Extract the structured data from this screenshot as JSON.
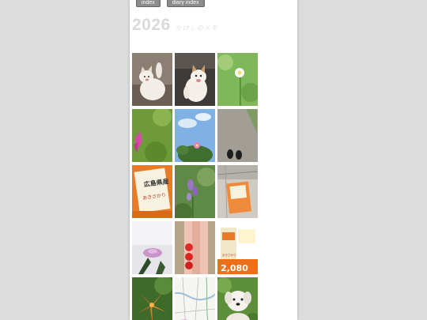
{
  "nav": {
    "index_label": "index",
    "diary_index_label": "diary index"
  },
  "header": {
    "year": "2026",
    "subtitle": "たけしのメモ"
  },
  "photos": [
    {
      "subject": "cat-photo"
    },
    {
      "subject": "cat-photo"
    },
    {
      "subject": "white-flower-photo"
    },
    {
      "subject": "pink-flower-photo"
    },
    {
      "subject": "sky-flower-photo"
    },
    {
      "subject": "shoes-on-pavement-photo"
    },
    {
      "subject": "rice-bag-photo"
    },
    {
      "subject": "purple-flower-photo"
    },
    {
      "subject": "rice-bag-cart-photo"
    },
    {
      "subject": "pink-blossom-photo"
    },
    {
      "subject": "tomatoes-photo"
    },
    {
      "subject": "rice-sale-ad-photo"
    },
    {
      "subject": "orange-lily-photo"
    },
    {
      "subject": "map-photo"
    },
    {
      "subject": "white-dog-photo"
    }
  ],
  "rice_bag": {
    "text": "広島県産",
    "variety": "あきさかり"
  },
  "ad": {
    "price": "2,080",
    "variety": "あきさかり"
  }
}
